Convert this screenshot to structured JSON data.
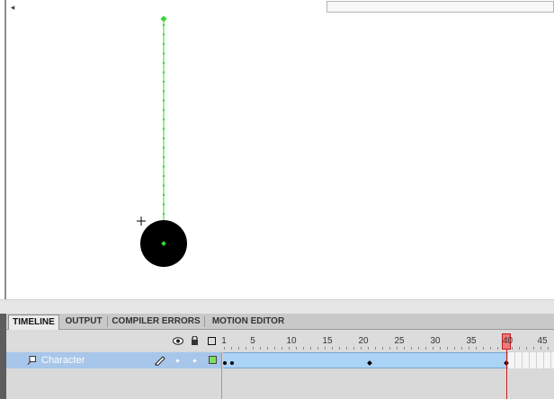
{
  "stage": {
    "motion_path_color": "#34d534",
    "object_color": "#000000"
  },
  "panel": {
    "tabs": [
      {
        "label": "TIMELINE",
        "active": true
      },
      {
        "label": "OUTPUT",
        "active": false
      },
      {
        "label": "COMPILER ERRORS",
        "active": false
      },
      {
        "label": "MOTION EDITOR",
        "active": false
      }
    ]
  },
  "timeline": {
    "header_icons": [
      "eye-icon",
      "lock-icon",
      "outline-icon"
    ],
    "ruler_labels": [
      "1",
      "5",
      "10",
      "15",
      "20",
      "25",
      "30",
      "35",
      "40",
      "45"
    ],
    "current_frame": "40",
    "layer": {
      "name": "Character",
      "color": "#7dde5d"
    }
  }
}
